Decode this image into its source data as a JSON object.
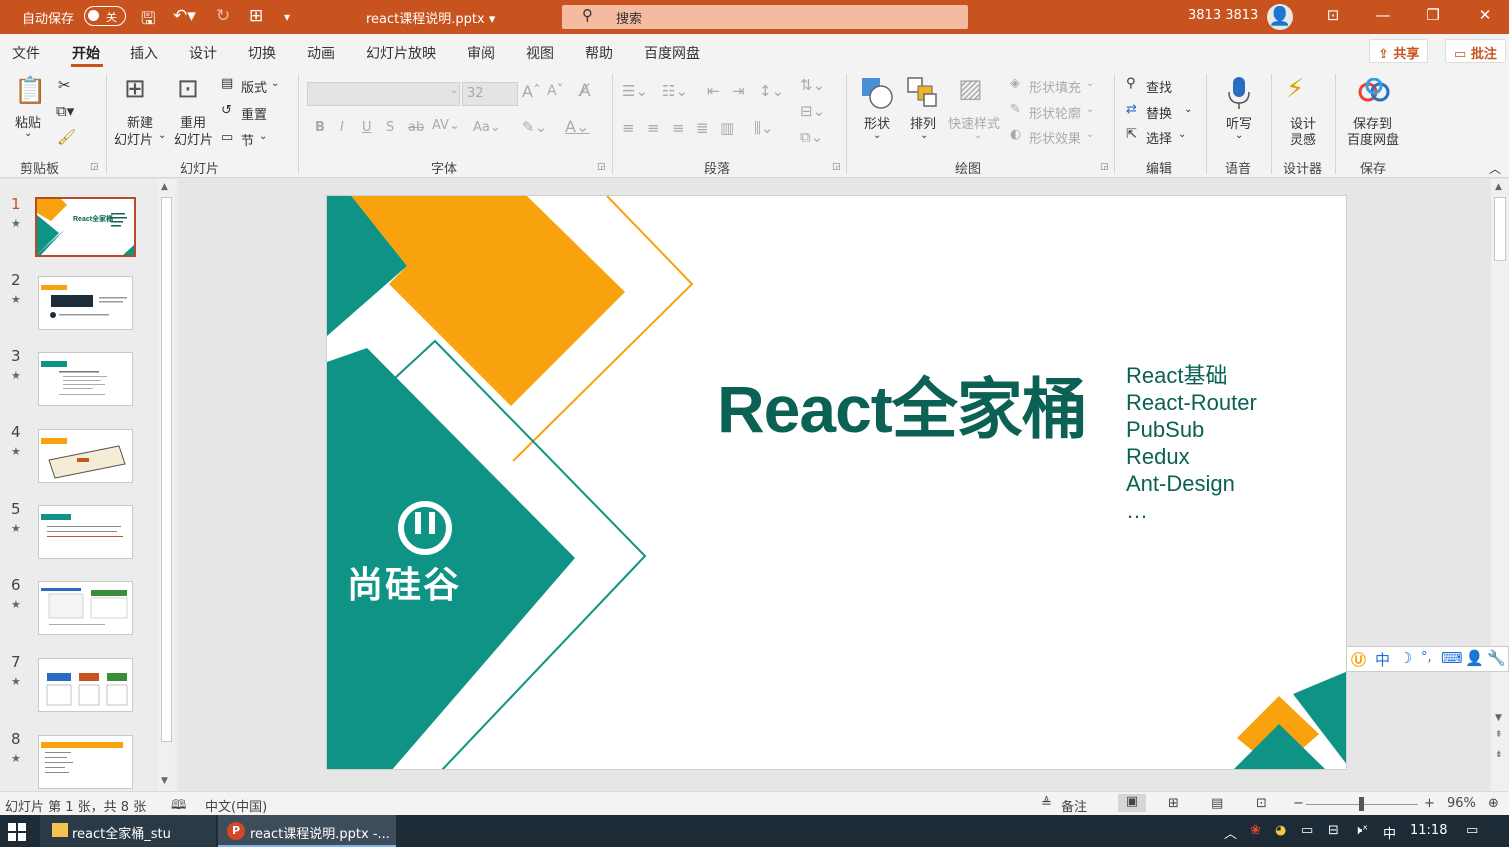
{
  "titlebar": {
    "autosave_label": "自动保存",
    "autosave_state": "关",
    "doc_title": "react课程说明.pptx ▾",
    "search_placeholder": "搜索",
    "user_name": "3813 3813"
  },
  "menu": {
    "items": [
      "文件",
      "开始",
      "插入",
      "设计",
      "切换",
      "动画",
      "幻灯片放映",
      "审阅",
      "视图",
      "帮助",
      "百度网盘"
    ],
    "active": "开始",
    "share_label": "共享",
    "comment_label": "批注"
  },
  "ribbon": {
    "clipboard": {
      "paste": "粘贴",
      "group": "剪贴板"
    },
    "slides": {
      "new_slide_1": "新建",
      "new_slide_2": "幻灯片",
      "reuse_1": "重用",
      "reuse_2": "幻灯片",
      "layout": "版式",
      "reset": "重置",
      "section": "节",
      "group": "幻灯片"
    },
    "font": {
      "size": "32",
      "group": "字体"
    },
    "paragraph": {
      "group": "段落"
    },
    "drawing": {
      "shapes": "形状",
      "arrange": "排列",
      "quick_styles": "快速样式",
      "shape_fill": "形状填充",
      "shape_outline": "形状轮廓",
      "shape_effects": "形状效果",
      "group": "绘图"
    },
    "editing": {
      "find": "查找",
      "replace": "替换",
      "select": "选择",
      "group": "编辑"
    },
    "voice": {
      "dictate": "听写",
      "group": "语音"
    },
    "designer": {
      "label_1": "设计",
      "label_2": "灵感",
      "group": "设计器"
    },
    "save": {
      "label_1": "保存到",
      "label_2": "百度网盘",
      "group": "保存"
    }
  },
  "thumbnails": [
    {
      "num": "1"
    },
    {
      "num": "2"
    },
    {
      "num": "3"
    },
    {
      "num": "4"
    },
    {
      "num": "5"
    },
    {
      "num": "6"
    },
    {
      "num": "7"
    },
    {
      "num": "8"
    }
  ],
  "slide": {
    "title": "React全家桶",
    "topics": [
      "React基础",
      "React-Router",
      "PubSub",
      "Redux",
      "Ant-Design",
      "…"
    ],
    "logo_text": "尚硅谷",
    "colors": {
      "teal": "#0e9384",
      "orange": "#f8a20d",
      "dark_green": "#0b6153"
    }
  },
  "ime": {
    "mode": "中"
  },
  "statusbar": {
    "slide_info": "幻灯片 第 1 张，共 8 张",
    "language": "中文(中国)",
    "notes": "备注",
    "zoom": "96%"
  },
  "taskbar": {
    "item1": "react全家桶_stu",
    "item2": "react课程说明.pptx -...",
    "ime": "中",
    "time": "11:18"
  }
}
